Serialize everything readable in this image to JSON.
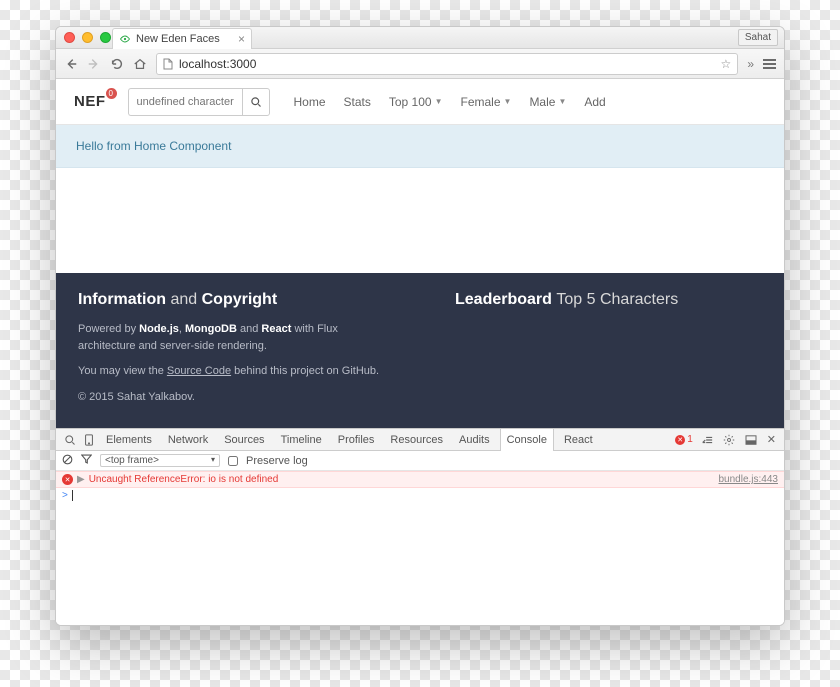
{
  "browser": {
    "tab_title": "New Eden Faces",
    "profile": "Sahat",
    "url": "localhost:3000"
  },
  "nav": {
    "brand": "NEF",
    "badge": "0",
    "search_placeholder": "undefined characters",
    "links": {
      "home": "Home",
      "stats": "Stats",
      "top100": "Top 100",
      "female": "Female",
      "male": "Male",
      "add": "Add"
    }
  },
  "hero": "Hello from Home Component",
  "footer": {
    "info_title_strong": "Information",
    "info_title_light": "and",
    "info_title_strong2": "Copyright",
    "powered_prefix": "Powered by ",
    "powered_node": "Node.js",
    "powered_sep1": ", ",
    "powered_mongo": "MongoDB",
    "powered_sep2": " and ",
    "powered_react": "React",
    "powered_suffix": " with Flux architecture and server-side rendering.",
    "view_prefix": "You may view the ",
    "source_code": "Source Code",
    "view_suffix": " behind this project on GitHub.",
    "copyright": "© 2015 Sahat Yalkabov.",
    "leaderboard_strong": "Leaderboard",
    "leaderboard_light": "Top 5 Characters"
  },
  "devtools": {
    "tabs": {
      "elements": "Elements",
      "network": "Network",
      "sources": "Sources",
      "timeline": "Timeline",
      "profiles": "Profiles",
      "resources": "Resources",
      "audits": "Audits",
      "console": "Console",
      "react": "React"
    },
    "error_count": "1",
    "frame_selector": "<top frame>",
    "preserve_log": "Preserve log",
    "error_message": "Uncaught ReferenceError: io is not defined",
    "error_source": "bundle.js:443",
    "prompt": ">"
  }
}
